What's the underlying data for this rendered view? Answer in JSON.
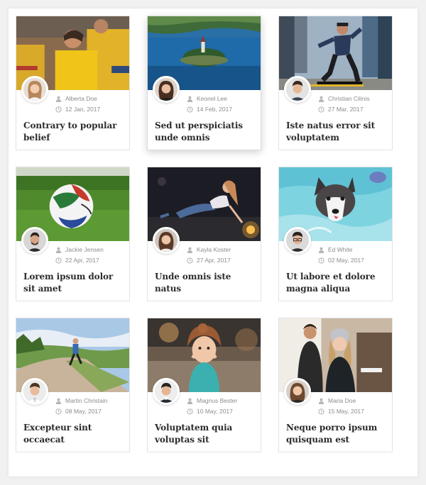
{
  "colors": {
    "page_background": "#f1f1f1",
    "panel_background": "#ffffff",
    "title_text": "#2c2c2c",
    "meta_text": "#8c8c8c"
  },
  "icons": {
    "author": "user-icon",
    "date": "clock-icon"
  },
  "posts": [
    {
      "author": "Alberta Doe",
      "date": "12 Jan, 2017",
      "title": "Contrary to popular belief",
      "image": "volunteers in yellow shirts"
    },
    {
      "author": "Keonel Lee",
      "date": "14 Feb, 2017",
      "title": "Sed ut perspiciatis unde omnis",
      "image": "island in a blue lake"
    },
    {
      "author": "Christian Cilinis",
      "date": "27 Mar, 2017",
      "title": "Iste natus error sit voluptatem",
      "image": "skateboarder in city"
    },
    {
      "author": "Jackie Jensen",
      "date": "22 Apr, 2017",
      "title": "Lorem ipsum dolor sit amet",
      "image": "soccer ball on grass"
    },
    {
      "author": "Kayla Koster",
      "date": "27 Apr, 2017",
      "title": "Unde omnis iste natus",
      "image": "woman with sparkler at night"
    },
    {
      "author": "Ed White",
      "date": "02 May, 2017",
      "title": "Ut labore et dolore magna aliqua",
      "image": "husky swimming in pool"
    },
    {
      "author": "Martin Christain",
      "date": "08 May, 2017",
      "title": "Excepteur sint occaecat",
      "image": "man running on country road"
    },
    {
      "author": "Magnus Bester",
      "date": "10 May, 2017",
      "title": "Voluptatem quia voluptas sit",
      "image": "little girl outdoors"
    },
    {
      "author": "Maria Doe",
      "date": "15 May, 2017",
      "title": "Neque porro ipsum quisquam est",
      "image": "woman in beanie at cafe"
    }
  ]
}
